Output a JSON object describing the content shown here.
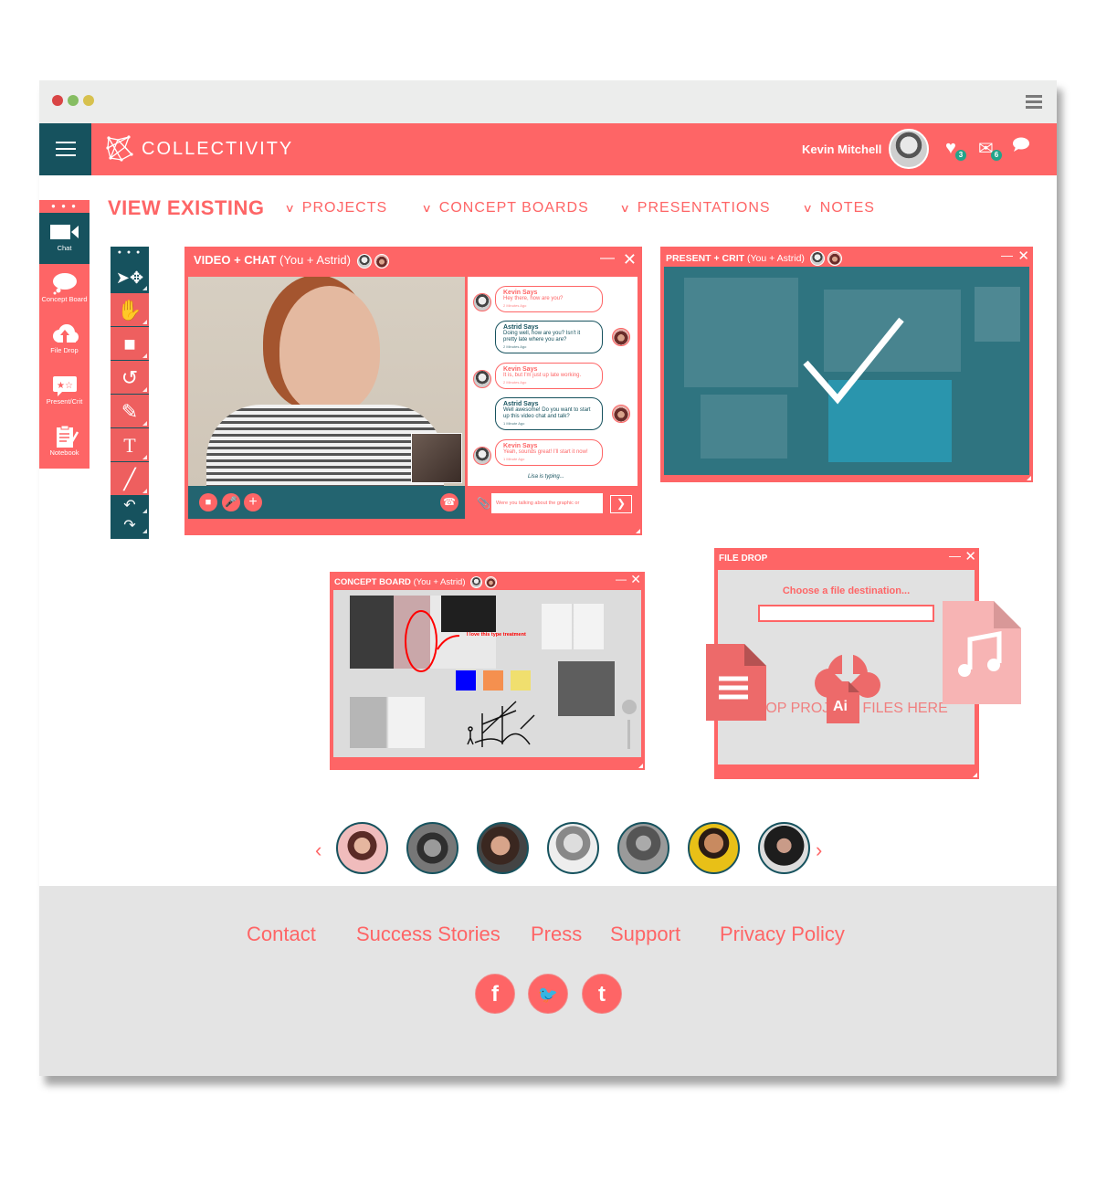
{
  "app": {
    "title": "COLLECTIVITY"
  },
  "colors": {
    "coral": "#fe6566",
    "teal": "#16525e",
    "badge": "#23a48a"
  },
  "header": {
    "user_name": "Kevin Mitchell",
    "user_chevron": "⌄",
    "likes_count": "3",
    "messages_count": "6",
    "icons": [
      "heart-icon",
      "mail-icon",
      "chat-bubble-icon"
    ]
  },
  "nav": {
    "title": "VIEW EXISTING",
    "items": [
      {
        "label": "PROJECTS"
      },
      {
        "label": "CONCEPT BOARDS"
      },
      {
        "label": "PRESENTATIONS"
      },
      {
        "label": "NOTES"
      }
    ],
    "chevron": "❯"
  },
  "left_rail": {
    "dots": "● ● ●",
    "items": [
      {
        "label": "Chat",
        "icon": "▶"
      },
      {
        "label": "Concept Board",
        "icon": "☁"
      },
      {
        "label": "File Drop",
        "icon": "⇧"
      },
      {
        "label": "Present/Crit",
        "icon": "★"
      },
      {
        "label": "Notebook",
        "icon": "✎"
      }
    ]
  },
  "tools": {
    "dots": "● ● ●",
    "items": [
      {
        "name": "select-move",
        "glyph": "➤"
      },
      {
        "name": "hand",
        "glyph": "✋"
      },
      {
        "name": "rectangle",
        "glyph": "■"
      },
      {
        "name": "rotate",
        "glyph": "↺"
      },
      {
        "name": "pencil",
        "glyph": "✎"
      },
      {
        "name": "text",
        "glyph": "T"
      },
      {
        "name": "line",
        "glyph": "╱"
      },
      {
        "name": "undo",
        "glyph": "↶"
      },
      {
        "name": "redo",
        "glyph": "↷"
      }
    ]
  },
  "video_chat": {
    "title": "VIDEO + CHAT",
    "participants": "(You + Astrid)",
    "messages": [
      {
        "sender": "Kevin Says",
        "text": "Hey there, how are you?",
        "time": "2 Minutes Ago",
        "who": "kevin"
      },
      {
        "sender": "Astrid Says",
        "text": "Doing well, how are you? Isn't it pretty late where you are?",
        "time": "2 Minutes Ago",
        "who": "astrid"
      },
      {
        "sender": "Kevin Says",
        "text": "It is, but I'm just up late working.",
        "time": "2 Minutes Ago",
        "who": "kevin"
      },
      {
        "sender": "Astrid Says",
        "text": "Well awesome! Do you want to start up this video chat and talk?",
        "time": "1 Minute Ago",
        "who": "astrid"
      },
      {
        "sender": "Kevin Says",
        "text": "Yeah, sounds great! I'll start it now!",
        "time": "1 Minute Ago",
        "who": "kevin"
      }
    ],
    "typing": "Lisa is typing...",
    "input_value": "Were you talking about the graphic or",
    "send_glyph": "❯"
  },
  "present_crit": {
    "title": "PRESENT + CRIT",
    "participants": "(You + Astrid)"
  },
  "concept_board": {
    "title": "CONCEPT BOARD",
    "participants": "(You + Astrid)",
    "annotation": "I love this type treatment",
    "swatches": [
      "#0000ff",
      "#f5904f",
      "#f0df6e"
    ]
  },
  "file_drop": {
    "title": "FILE DROP",
    "label": "Choose a file destination...",
    "destination_value": "",
    "drop_text": "DROP PROJECT FILES HERE",
    "ai_label": "Ai"
  },
  "carousel": {
    "prev": "‹",
    "next": "›",
    "people": [
      {
        "bg": "radial-gradient(circle at 50% 45%, #e5b69f 0 22%, #5a2b26 23% 40%, #f0bcbc 41%)"
      },
      {
        "bg": "radial-gradient(circle at 50% 50%, #9a9a9a 0 25%, #2f2f2f 26% 45%, #777 46%)"
      },
      {
        "bg": "radial-gradient(circle at 45% 45%, #d7a48a 0 25%, #3a2720 26% 50%, #444 51%)"
      },
      {
        "bg": "radial-gradient(circle at 50% 40%, #ddd 0 25%, #888 26% 45%, #eee 46%)"
      },
      {
        "bg": "radial-gradient(circle at 50% 40%, #aaa 0 20%, #555 21% 45%, #9a9a9a 46%)"
      },
      {
        "bg": "radial-gradient(circle at 50% 40%, #c88a60 0 25%, #2a1c15 26% 40%, #e8c017 41%)"
      },
      {
        "bg": "radial-gradient(circle at 50% 45%, #c99b88 0 20%, #1d1d1d 21% 55%, #ddd 56%)"
      }
    ]
  },
  "footer": {
    "links": [
      {
        "label": "Contact"
      },
      {
        "label": "Success Stories"
      },
      {
        "label": "Press"
      },
      {
        "label": "Support"
      },
      {
        "label": "Privacy Policy"
      }
    ],
    "social": [
      {
        "name": "facebook",
        "glyph": "f"
      },
      {
        "name": "twitter",
        "glyph": "🐦"
      },
      {
        "name": "tumblr",
        "glyph": "t"
      }
    ]
  }
}
